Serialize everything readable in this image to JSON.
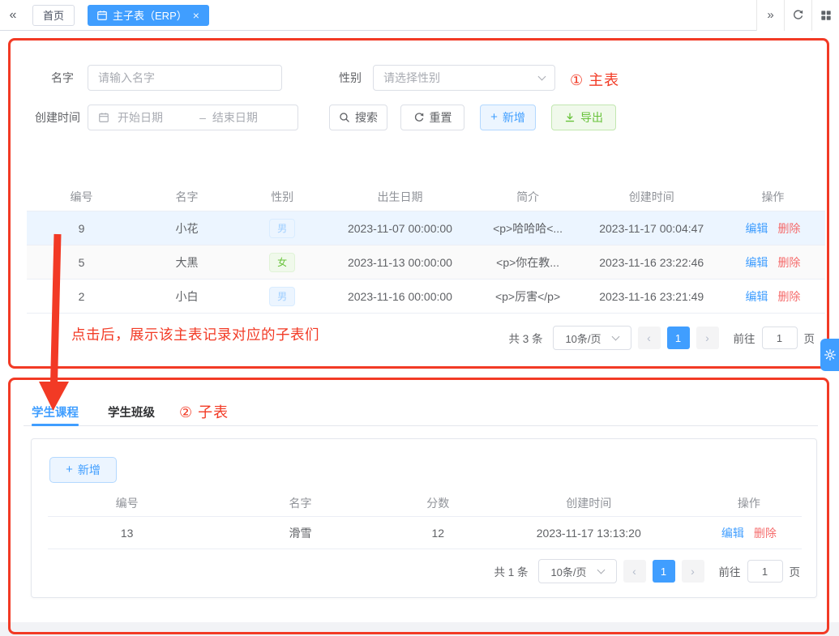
{
  "colors": {
    "accent": "#409eff",
    "success": "#67c23a",
    "danger": "#f56c6c",
    "annotation_red": "#f23a25"
  },
  "tabbar": {
    "collapse_glyph": "«",
    "expand_glyph": "»",
    "home_tab": "首页",
    "active_tab": "主子表（ERP）",
    "close_glyph": "×",
    "icons": [
      "calendar-icon",
      "refresh-icon",
      "layout-grid-icon"
    ]
  },
  "master": {
    "annotation": "① 主表",
    "note": "点击后，展示该主表记录对应的子表们",
    "form": {
      "name_label": "名字",
      "name_placeholder": "请输入名字",
      "gender_label": "性别",
      "gender_placeholder": "请选择性别",
      "created_label": "创建时间",
      "date_start": "开始日期",
      "date_sep": "–",
      "date_end": "结束日期",
      "search": "搜索",
      "reset": "重置",
      "add": "新增",
      "export": "导出"
    },
    "table": {
      "headers": [
        "编号",
        "名字",
        "性别",
        "出生日期",
        "简介",
        "创建时间",
        "操作"
      ],
      "rows": [
        {
          "id": "9",
          "name": "小花",
          "gender": "男",
          "birth": "2023-11-07 00:00:00",
          "intro": "<p>哈哈哈<...",
          "created": "2023-11-17 00:04:47",
          "edit": "编辑",
          "del": "删除"
        },
        {
          "id": "5",
          "name": "大黑",
          "gender": "女",
          "birth": "2023-11-13 00:00:00",
          "intro": "<p>你在教...",
          "created": "2023-11-16 23:22:46",
          "edit": "编辑",
          "del": "删除"
        },
        {
          "id": "2",
          "name": "小白",
          "gender": "男",
          "birth": "2023-11-16 00:00:00",
          "intro": "<p>厉害</p>",
          "created": "2023-11-16 23:21:49",
          "edit": "编辑",
          "del": "删除"
        }
      ]
    },
    "pagination": {
      "total": "共 3 条",
      "size": "10条/页",
      "prev": "‹",
      "page": "1",
      "next": "›",
      "goto": "前往",
      "goto_value": "1",
      "unit": "页"
    }
  },
  "sub": {
    "annotation": "② 子表",
    "tabs": [
      {
        "label": "学生课程"
      },
      {
        "label": "学生班级"
      }
    ],
    "add": "新增",
    "table": {
      "headers": [
        "编号",
        "名字",
        "分数",
        "创建时间",
        "操作"
      ],
      "rows": [
        {
          "id": "13",
          "name": "滑雪",
          "score": "12",
          "created": "2023-11-17 13:13:20",
          "edit": "编辑",
          "del": "删除"
        }
      ]
    },
    "pagination": {
      "total": "共 1 条",
      "size": "10条/页",
      "prev": "‹",
      "page": "1",
      "next": "›",
      "goto": "前往",
      "goto_value": "1",
      "unit": "页"
    }
  }
}
